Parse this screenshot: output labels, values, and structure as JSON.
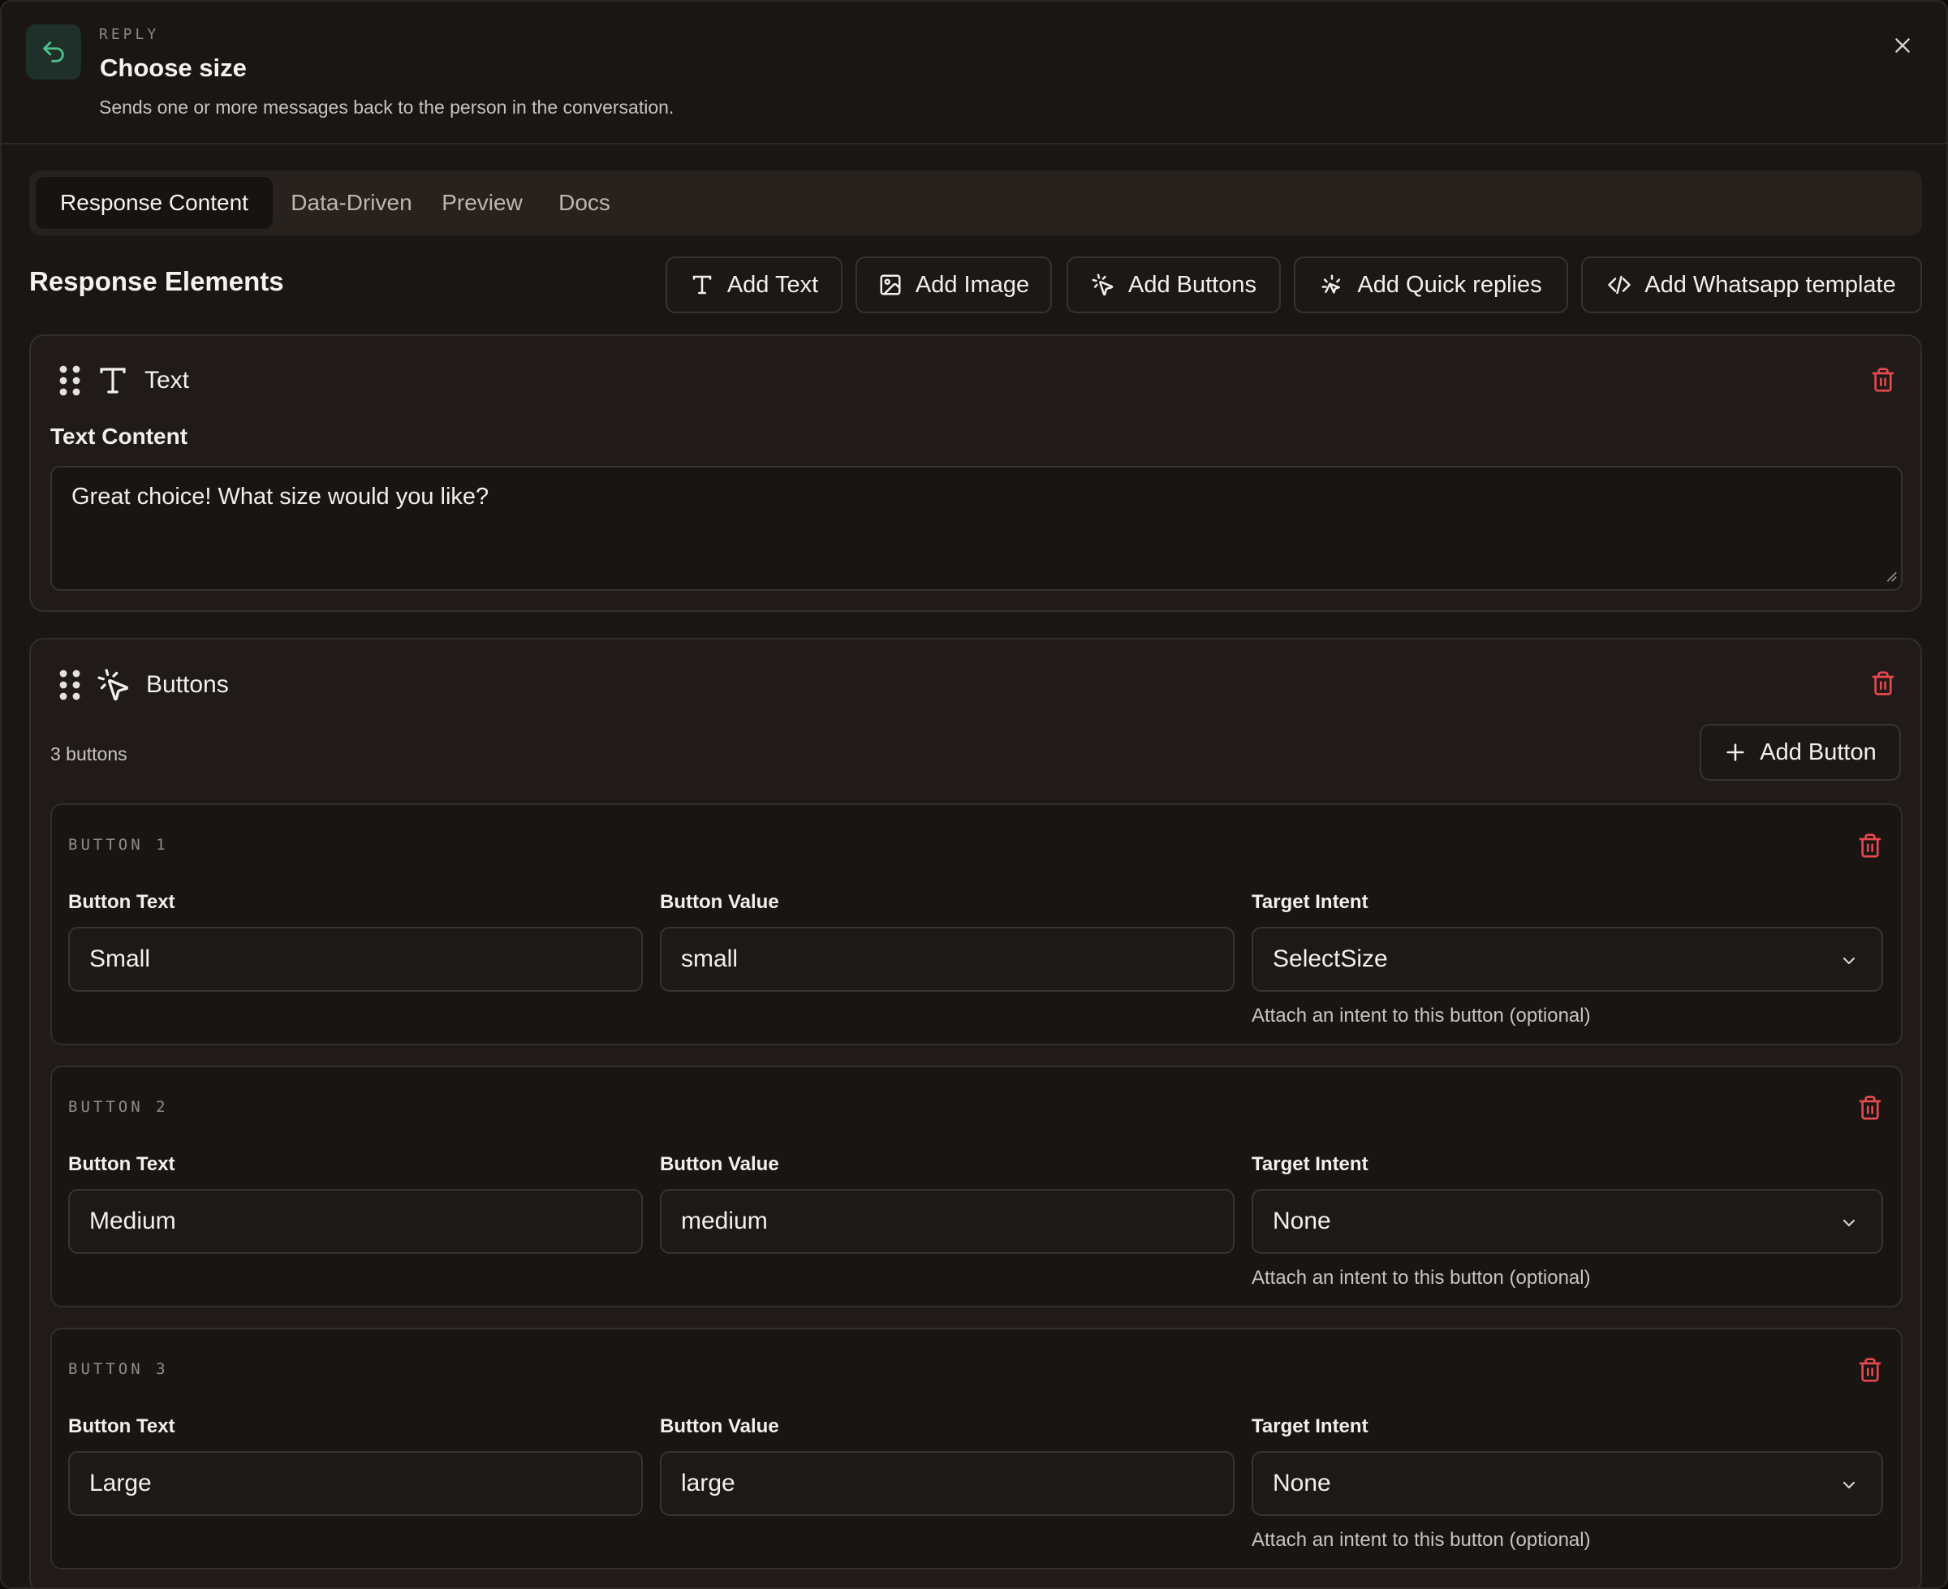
{
  "header": {
    "kicker": "REPLY",
    "title": "Choose size",
    "description": "Sends one or more messages back to the person in the conversation."
  },
  "tabs": [
    {
      "label": "Response Content",
      "active": true
    },
    {
      "label": "Data-Driven",
      "active": false
    },
    {
      "label": "Preview",
      "active": false
    },
    {
      "label": "Docs",
      "active": false
    }
  ],
  "section": {
    "title": "Response Elements",
    "toolbar": {
      "add_text": "Add Text",
      "add_image": "Add Image",
      "add_buttons": "Add Buttons",
      "add_quick_replies": "Add Quick replies",
      "add_whatsapp": "Add Whatsapp template"
    }
  },
  "text_card": {
    "label": "Text",
    "field_label": "Text Content",
    "content": "Great choice! What size would you like?"
  },
  "buttons_card": {
    "label": "Buttons",
    "count_text": "3 buttons",
    "add_button_label": "Add Button",
    "field_labels": {
      "text": "Button Text",
      "value": "Button Value",
      "intent": "Target Intent"
    },
    "helper": "Attach an intent to this button (optional)",
    "items": [
      {
        "heading": "BUTTON 1",
        "text": "Small",
        "value": "small",
        "intent": "SelectSize"
      },
      {
        "heading": "BUTTON 2",
        "text": "Medium",
        "value": "medium",
        "intent": "None"
      },
      {
        "heading": "BUTTON 3",
        "text": "Large",
        "value": "large",
        "intent": "None"
      }
    ]
  },
  "colors": {
    "background": "#1a1614",
    "card": "#201b19",
    "accent_green": "#4fbf8a",
    "danger": "#e5484d",
    "text": "#f2efec"
  },
  "icons": {
    "header": "reply-arrow-icon",
    "close": "close-icon",
    "text": "text-type-icon",
    "image": "image-icon",
    "buttons": "pointer-click-icon",
    "quick_replies": "sparkle-pointer-icon",
    "whatsapp": "code-icon",
    "drag": "drag-handle-icon",
    "delete": "trash-icon",
    "add": "plus-icon",
    "dropdown": "chevron-down-icon"
  }
}
